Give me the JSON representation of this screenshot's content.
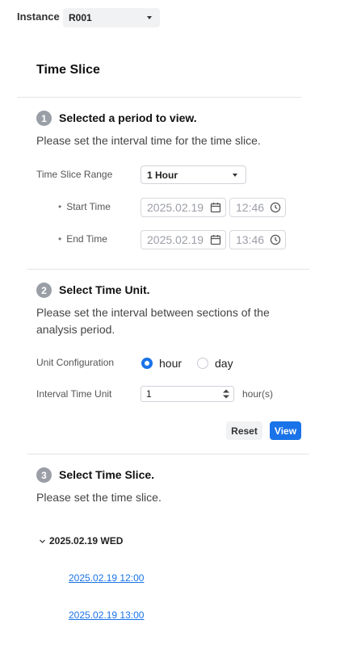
{
  "instance": {
    "label": "Instance",
    "selected": "R001"
  },
  "panel": {
    "title": "Time Slice"
  },
  "step1": {
    "number": "1",
    "title": "Selected a period to view.",
    "description": "Please set the interval time for the time slice.",
    "range_label": "Time Slice Range",
    "range_value": "1 Hour",
    "start_label": "Start Time",
    "start_date": "2025.02.19",
    "start_time": "12:46",
    "end_label": "End Time",
    "end_date": "2025.02.19",
    "end_time": "13:46"
  },
  "step2": {
    "number": "2",
    "title": "Select Time Unit.",
    "description_line1": "Please set the interval between sections of the",
    "description_line2": "analysis period.",
    "unit_config_label": "Unit Configuration",
    "unit_options": [
      {
        "label": "hour",
        "selected": true
      },
      {
        "label": "day",
        "selected": false
      }
    ],
    "interval_label": "Interval Time Unit",
    "interval_value": "1",
    "interval_suffix": "hour(s)",
    "reset_label": "Reset",
    "view_label": "View"
  },
  "step3": {
    "number": "3",
    "title": "Select Time Slice.",
    "description": "Please set the time slice.",
    "group_label": "2025.02.19 WED",
    "slices": [
      "2025.02.19 12:00",
      "2025.02.19 13:00"
    ]
  },
  "colors": {
    "accent": "#1a73e8",
    "badge": "#9a9ea6"
  },
  "icons": {
    "calendar": "calendar-icon",
    "clock": "clock-icon",
    "caret": "chevron-down-icon"
  }
}
